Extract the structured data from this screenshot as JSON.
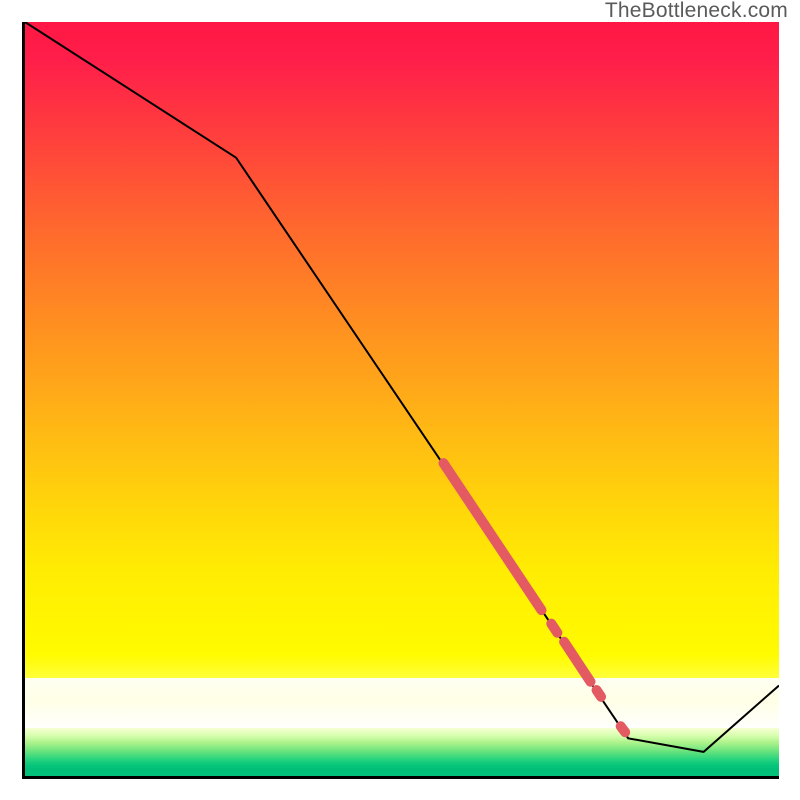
{
  "watermark": "TheBottleneck.com",
  "gradient": {
    "top": "#ff1744",
    "mid": "#ffd500",
    "bottom_green": "#02c27b"
  },
  "chart_data": {
    "type": "line",
    "title": "",
    "xlabel": "",
    "ylabel": "",
    "xlim": [
      0,
      100
    ],
    "ylim": [
      0,
      100
    ],
    "curve": {
      "x": [
        0,
        28,
        80,
        90,
        100
      ],
      "y": [
        100,
        82,
        5,
        3.2,
        12
      ]
    },
    "highlight_segments": [
      {
        "x": [
          55.5,
          68.5
        ],
        "y": [
          41.5,
          22
        ],
        "kind": "thick"
      },
      {
        "x": [
          69.8,
          70.6
        ],
        "y": [
          20.2,
          19.0
        ],
        "kind": "dot"
      },
      {
        "x": [
          71.5,
          75.0
        ],
        "y": [
          17.8,
          12.5
        ],
        "kind": "short"
      },
      {
        "x": [
          75.8,
          76.4
        ],
        "y": [
          11.4,
          10.5
        ],
        "kind": "dot"
      },
      {
        "x": [
          79.0,
          79.6
        ],
        "y": [
          6.6,
          5.8
        ],
        "kind": "dot"
      }
    ],
    "highlight_color": "#e35a63",
    "curve_color": "#000000"
  }
}
